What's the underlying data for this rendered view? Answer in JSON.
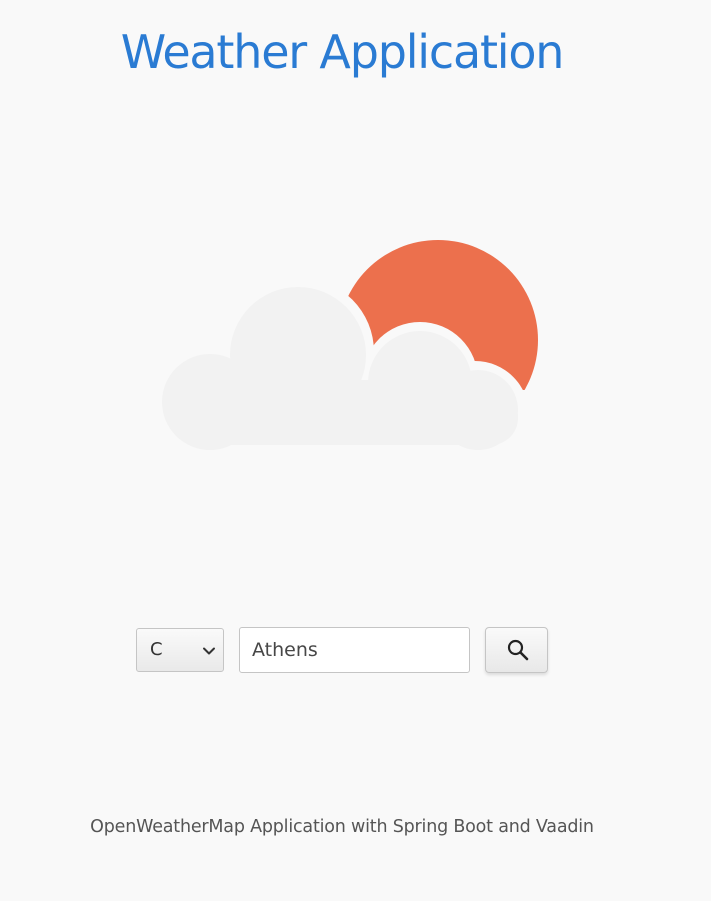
{
  "header": {
    "title": "Weather Application"
  },
  "weather_icon": {
    "icon": "partly-cloudy-sun-icon",
    "cloud_color": "#f2f2f2",
    "sun_color": "#ec704d"
  },
  "controls": {
    "unit_select": {
      "selected": "C"
    },
    "city_input": {
      "value": "Athens"
    },
    "search_button": {
      "icon": "search-icon"
    }
  },
  "footer": {
    "text": "OpenWeatherMap Application with Spring Boot and Vaadin"
  },
  "colors": {
    "accent": "#2a7bd3",
    "background": "#f9f9f9"
  }
}
